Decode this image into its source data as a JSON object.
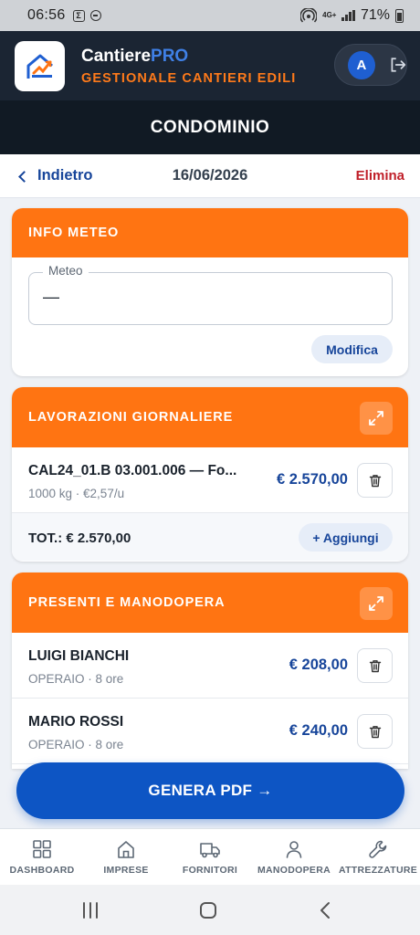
{
  "status_bar": {
    "time": "06:56",
    "notif_badge": "Σ",
    "network": "4G+",
    "battery": "71%"
  },
  "header": {
    "brand_main": "Cantiere",
    "brand_accent": "PRO",
    "subtitle": "GESTIONALE CANTIERI EDILI",
    "avatar_initial": "A"
  },
  "page": {
    "title": "CONDOMINIO"
  },
  "nav": {
    "back_label": "Indietro",
    "date": "16/06/2026",
    "delete_label": "Elimina"
  },
  "meteo": {
    "header": "INFO METEO",
    "field_label": "Meteo",
    "field_value": "—",
    "edit_label": "Modifica"
  },
  "lavorazioni": {
    "header": "LAVORAZIONI GIORNALIERE",
    "items": [
      {
        "title": "CAL24_01.B 03.001.006 — Fo...",
        "subtitle": "1000 kg · €2,57/u",
        "amount": "€ 2.570,00"
      }
    ],
    "total": "TOT.: € 2.570,00",
    "add_label": "+ Aggiungi"
  },
  "presenti": {
    "header": "PRESENTI E MANODOPERA",
    "items": [
      {
        "name": "LUIGI BIANCHI",
        "subtitle": "OPERAIO · 8 ore",
        "amount": "€ 208,00"
      },
      {
        "name": "MARIO ROSSI",
        "subtitle": "OPERAIO · 8 ore",
        "amount": "€ 240,00"
      }
    ]
  },
  "pdf_button": "GENERA PDF →",
  "bottom_nav": [
    {
      "label": "DASHBOARD",
      "icon": "grid-icon"
    },
    {
      "label": "IMPRESE",
      "icon": "home-icon"
    },
    {
      "label": "FORNITORI",
      "icon": "truck-icon"
    },
    {
      "label": "MANODOPERA",
      "icon": "user-icon"
    },
    {
      "label": "ATTREZZATURE",
      "icon": "wrench-icon"
    }
  ],
  "colors": {
    "accent": "#ff7412",
    "primary": "#0d55c4",
    "header_bg": "#1b2533",
    "danger": "#c0202a"
  }
}
